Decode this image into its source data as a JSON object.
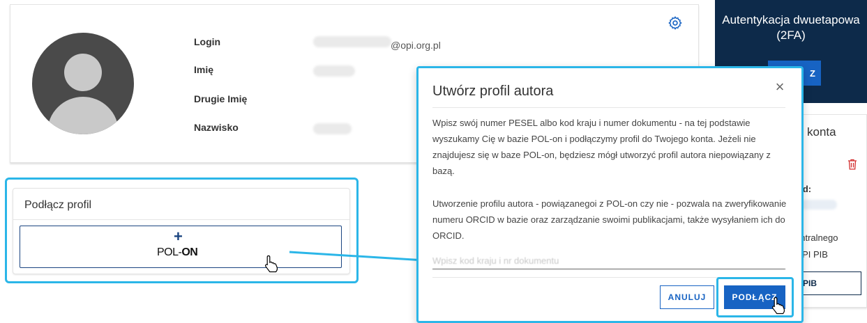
{
  "profile": {
    "fields": [
      {
        "label": "Login"
      },
      {
        "label": "Imię"
      },
      {
        "label": "Drugie Imię"
      },
      {
        "label": "Nazwisko"
      }
    ],
    "email_domain": "@opi.org.pl",
    "settings_icon": "gear-icon"
  },
  "sidebar": {
    "twofa_title": "Autentykacja dwuetapowa (2FA)",
    "twofa_button": "Z",
    "account_title": "konta",
    "orcid_label": "cid:",
    "text_line1": "entralnego",
    "text_line2": "OPI PIB",
    "button": "PIB"
  },
  "connect_card": {
    "title": "Podłącz profil",
    "plus": "+",
    "logo_pol": "POL-",
    "logo_on": "ON"
  },
  "modal": {
    "title": "Utwórz profil autora",
    "paragraph1": "Wpisz swój numer PESEL albo kod kraju i numer dokumentu - na tej podstawie wyszukamy Cię w bazie POL-on i podłączymy profil do Twojego konta. Jeżeli nie znajdujesz się w baze POL-on, będziesz mógł utworzyć profil autora niepowiązany z bazą.",
    "paragraph2": "Utworzenie profilu autora - powiązanegoi z POL-on czy nie - pozwala na zweryfikowanie numeru ORCID w bazie oraz zarządzanie swoimi publikacjami, także wysyłaniem ich do ORCID.",
    "input_placeholder": "Wpisz kod kraju i nr dokumentu",
    "cancel_label": "ANULUJ",
    "connect_label": "PODŁĄCZ",
    "close_symbol": "×"
  },
  "colors": {
    "accent": "#1763c3",
    "highlight": "#2bb6e8",
    "dark_navy": "#0d2a4a"
  }
}
